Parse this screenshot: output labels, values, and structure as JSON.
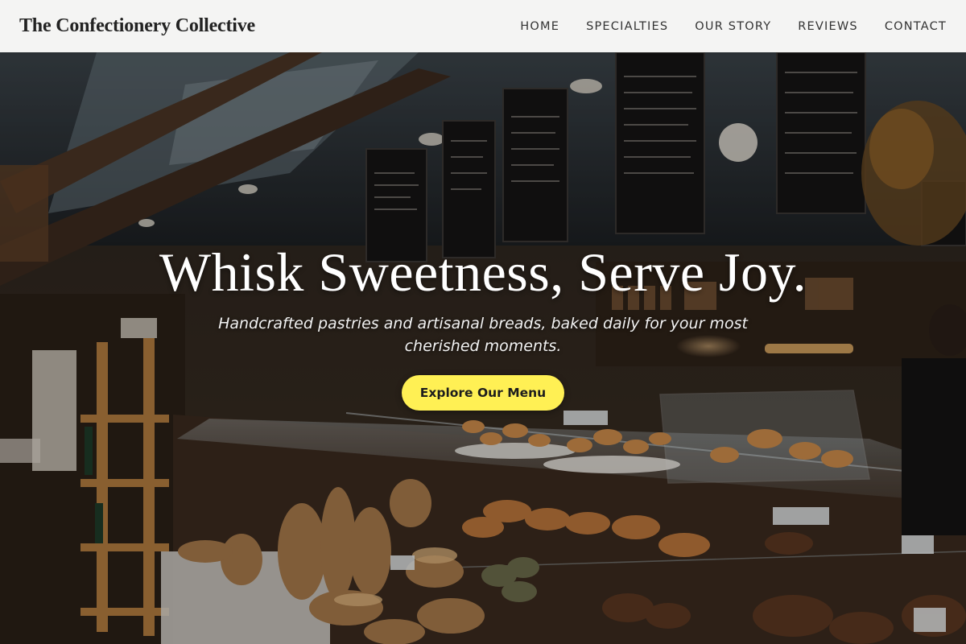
{
  "header": {
    "brand": "The Confectionery Collective",
    "nav": [
      {
        "label": "HOME"
      },
      {
        "label": "SPECIALTIES"
      },
      {
        "label": "OUR STORY"
      },
      {
        "label": "REVIEWS"
      },
      {
        "label": "CONTACT"
      }
    ]
  },
  "hero": {
    "title": "Whisk Sweetness, Serve Joy.",
    "subtitle": "Handcrafted pastries and artisanal breads, baked daily for your most cherished moments.",
    "cta_label": "Explore Our Menu",
    "background_image": "bakery-market-photo"
  },
  "colors": {
    "header_bg": "#f4f4f3",
    "brand_text": "#222222",
    "cta_bg": "#fff054",
    "cta_text": "#1d1d1d",
    "hero_text": "#ffffff"
  }
}
